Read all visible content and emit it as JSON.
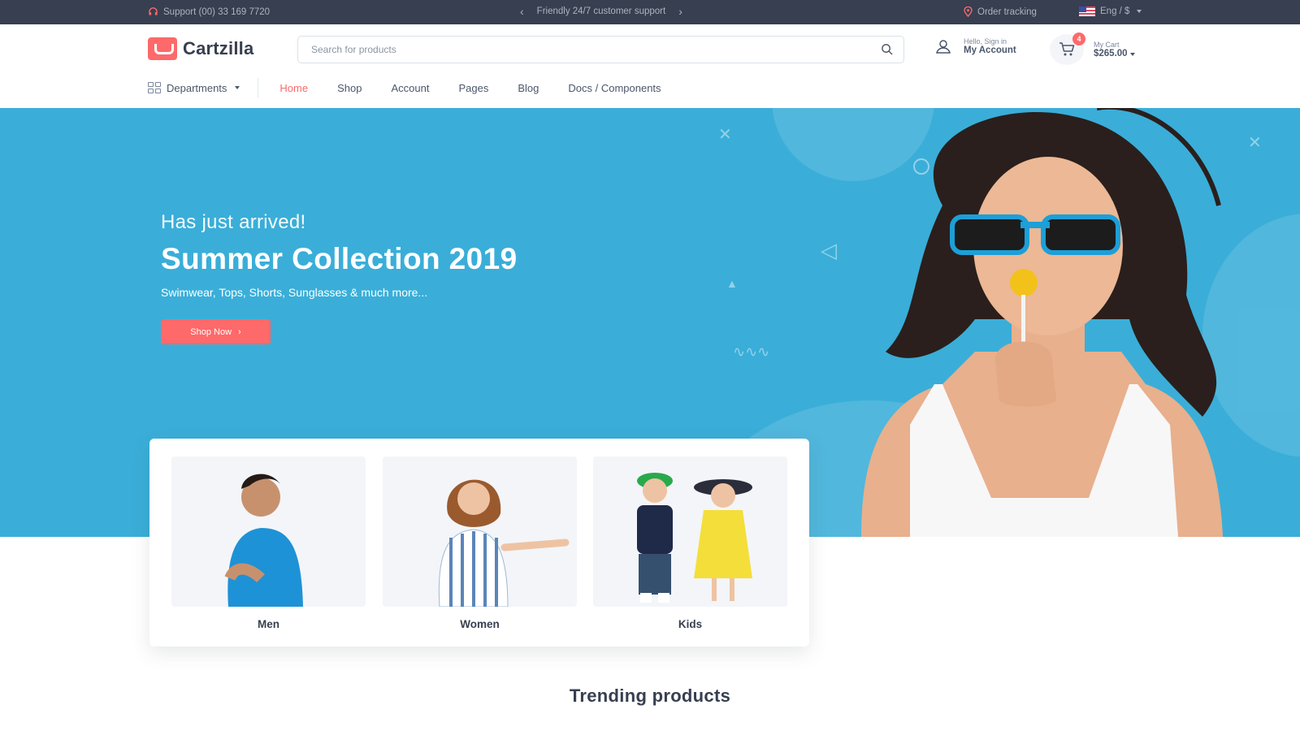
{
  "topbar": {
    "support": "Support (00) 33 169 7720",
    "promo": "Friendly 24/7 customer support",
    "order_tracking": "Order tracking",
    "lang": "Eng / $"
  },
  "header": {
    "logo": "Cartzilla",
    "search_placeholder": "Search for products",
    "account_hint": "Hello, Sign in",
    "account_label": "My Account",
    "cart_badge": "4",
    "cart_hint": "My Cart",
    "cart_total": "$265.00"
  },
  "nav": {
    "departments": "Departments",
    "items": [
      {
        "label": "Home",
        "active": true
      },
      {
        "label": "Shop"
      },
      {
        "label": "Account"
      },
      {
        "label": "Pages"
      },
      {
        "label": "Blog"
      },
      {
        "label": "Docs / Components"
      }
    ]
  },
  "hero": {
    "kicker": "Has just arrived!",
    "title": "Summer Collection 2019",
    "subtitle": "Swimwear, Tops, Shorts, Sunglasses & much more...",
    "button": "Shop Now"
  },
  "categories": [
    {
      "label": "Men"
    },
    {
      "label": "Women"
    },
    {
      "label": "Kids"
    }
  ],
  "trending": "Trending products",
  "colors": {
    "accent": "#fe696a",
    "hero_bg": "#3aaed8",
    "topbar_bg": "#373f50"
  }
}
